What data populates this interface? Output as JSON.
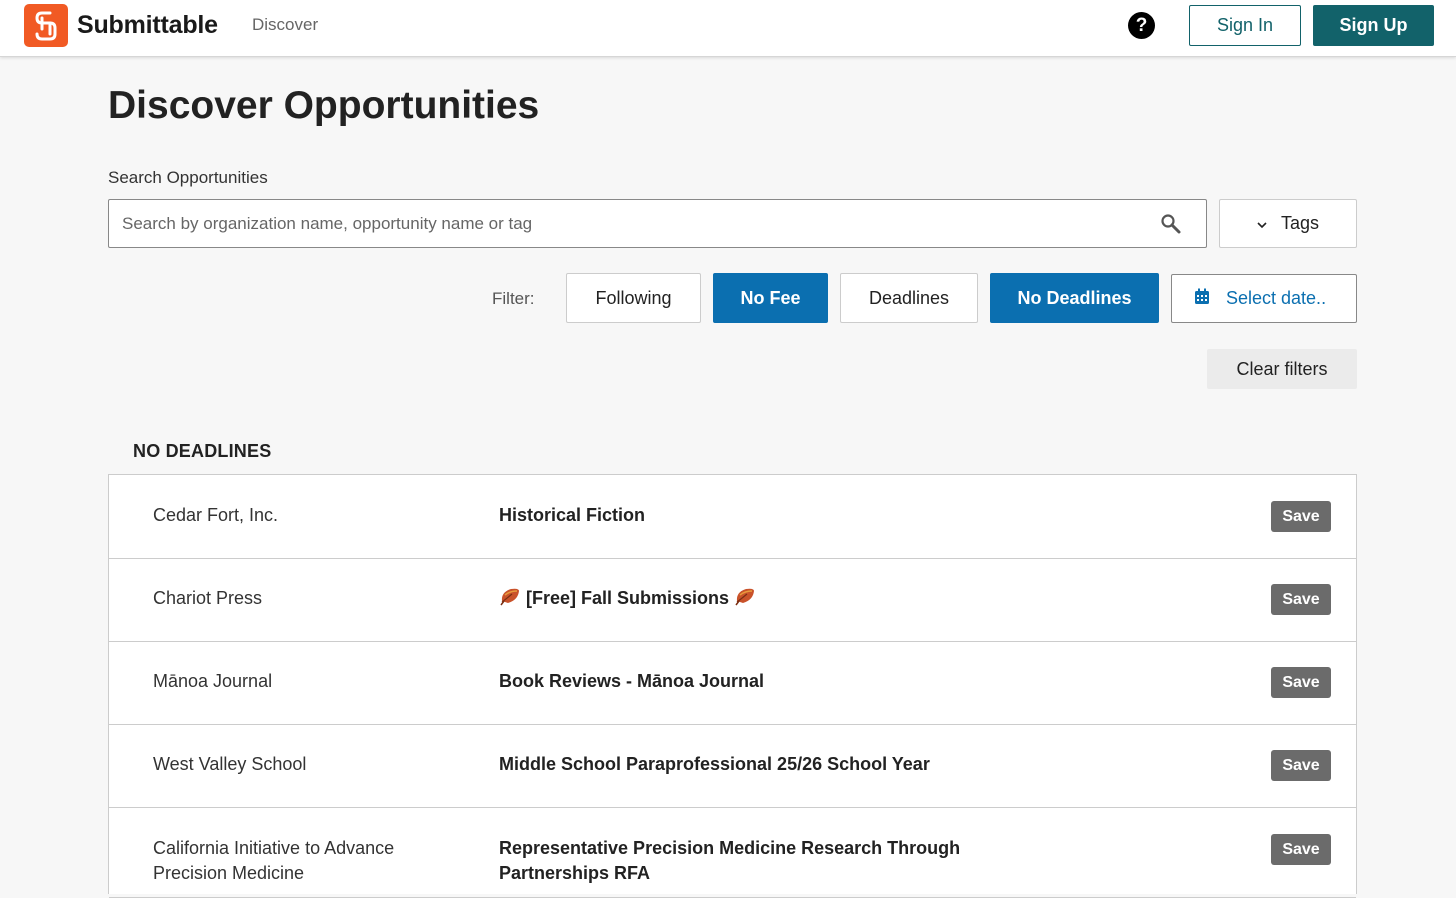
{
  "header": {
    "brand": "Submittable",
    "nav_discover": "Discover",
    "help_symbol": "?",
    "sign_in": "Sign In",
    "sign_up": "Sign Up",
    "brand_color": "#f15a24",
    "accent_color": "#12626a"
  },
  "main": {
    "title": "Discover Opportunities",
    "search_label": "Search Opportunities",
    "search_placeholder": "Search by organization name, opportunity name or tag",
    "search_value": "",
    "tags_label": "Tags",
    "filter_label": "Filter:",
    "filters": [
      {
        "label": "Following",
        "active": false
      },
      {
        "label": "No Fee",
        "active": true
      },
      {
        "label": "Deadlines",
        "active": false
      },
      {
        "label": "No Deadlines",
        "active": true
      }
    ],
    "date_label": "Select date..",
    "clear_label": "Clear filters",
    "filter_active_color": "#0b6fb0"
  },
  "list": {
    "heading": "NO DEADLINES",
    "save_label": "Save",
    "rows": [
      {
        "org": "Cedar Fort, Inc.",
        "opportunity": "Historical Fiction"
      },
      {
        "org": "Chariot Press",
        "opportunity": "[Free] Fall Submissions"
      },
      {
        "org": "Mānoa Journal",
        "opportunity": "Book Reviews - Mānoa Journal"
      },
      {
        "org": "West Valley School",
        "opportunity": "Middle School Paraprofessional 25/26 School Year"
      },
      {
        "org": "California Initiative to Advance Precision Medicine",
        "opportunity": "Representative Precision Medicine Research Through Partnerships RFA"
      }
    ]
  }
}
